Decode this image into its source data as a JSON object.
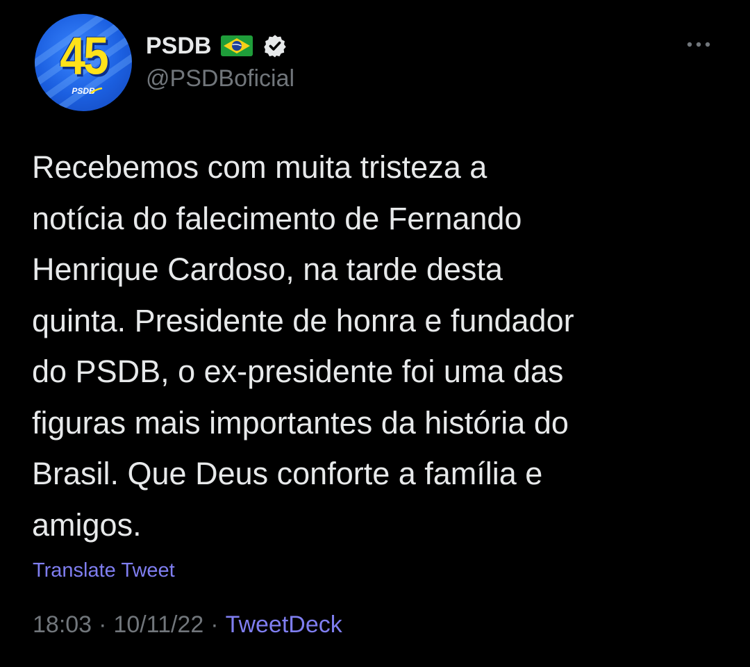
{
  "account": {
    "avatar_number": "45",
    "avatar_logo_text": "PSDB",
    "display_name": "PSDB",
    "handle": "@PSDBoficial",
    "flag_icon": "brazil-flag-icon",
    "verified_icon": "verified-badge-icon"
  },
  "tweet": {
    "text_lines": [
      "Recebemos com muita tristeza a",
      "notícia do falecimento de Fernando",
      "Henrique Cardoso, na tarde desta",
      "quinta. Presidente de honra e fundador",
      "do PSDB, o ex-presidente foi uma das",
      "figuras mais importantes da história do",
      "Brasil. Que Deus conforte a família e",
      "amigos."
    ],
    "translate_label": "Translate Tweet",
    "time": "18:03",
    "separator": "·",
    "date": "10/11/22",
    "source": "TweetDeck"
  },
  "colors": {
    "background": "#000000",
    "text": "#e7e9ea",
    "secondary_text": "#71767b",
    "link": "#7f7ef0",
    "avatar_blue": "#1b5fe0",
    "avatar_yellow": "#ffe21a"
  }
}
